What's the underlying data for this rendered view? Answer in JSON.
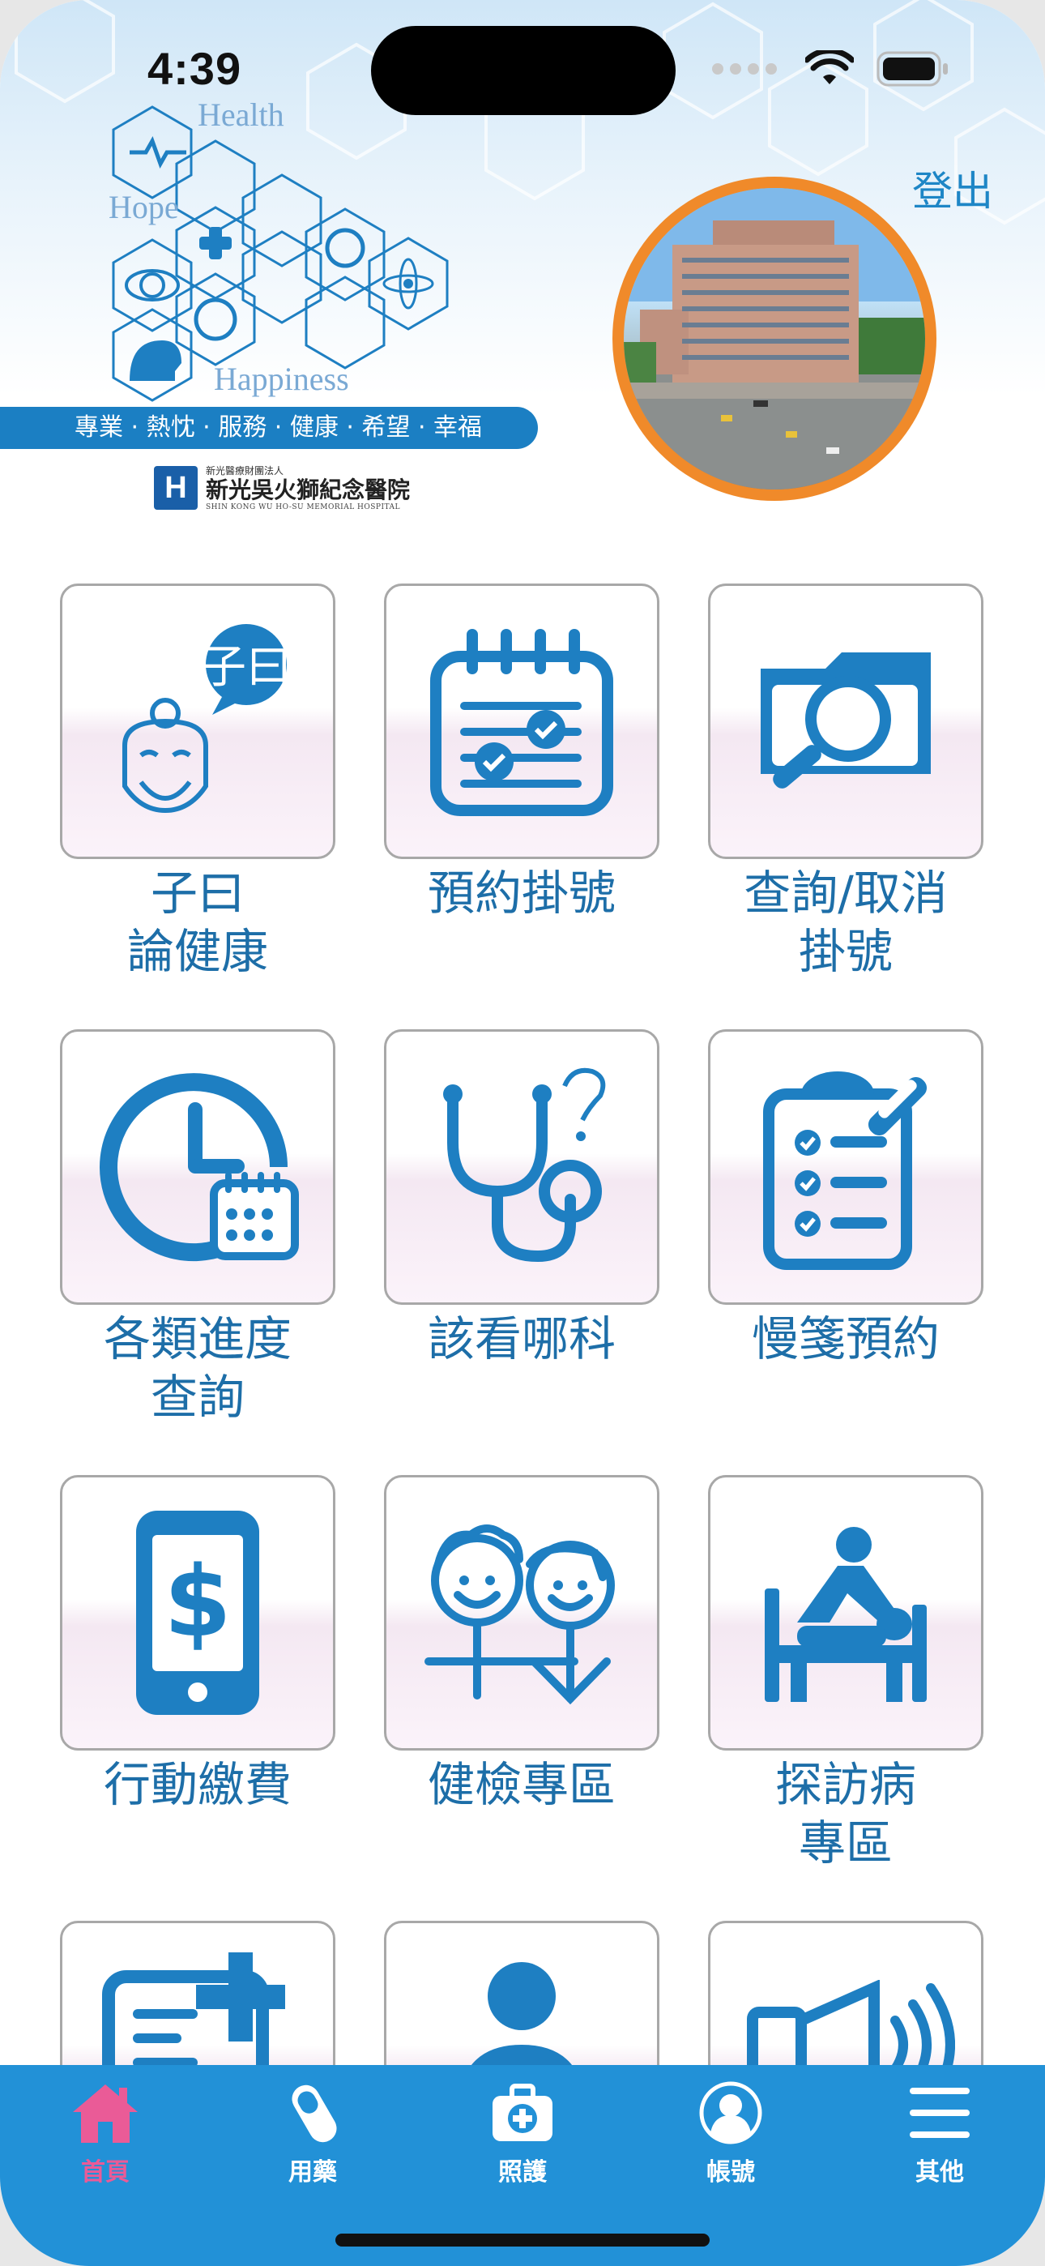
{
  "status_bar": {
    "time": "4:39"
  },
  "header": {
    "logout_label": "登出",
    "logo_words": [
      "Health",
      "Hope",
      "Happiness"
    ],
    "slogan": "專業 · 熱忱 · 服務 · 健康 · 希望 · 幸福",
    "hospital": {
      "small": "新光醫療財團法人",
      "name": "新光吳火獅紀念醫院",
      "en": "SHIN KONG WU HO-SU MEMORIAL HOSPITAL"
    }
  },
  "grid": {
    "tiles": [
      {
        "label": "子曰\n論健康",
        "icon": "confucius-icon"
      },
      {
        "label": "預約掛號",
        "icon": "calendar-check-icon"
      },
      {
        "label": "查詢/取消\n掛號",
        "icon": "folder-search-icon"
      },
      {
        "label": "各類進度\n查詢",
        "icon": "clock-calendar-icon"
      },
      {
        "label": "該看哪科",
        "icon": "stethoscope-question-icon"
      },
      {
        "label": "慢箋預約",
        "icon": "clipboard-checklist-icon"
      },
      {
        "label": "行動繳費",
        "icon": "phone-dollar-icon"
      },
      {
        "label": "健檢專區",
        "icon": "health-check-people-icon"
      },
      {
        "label": "探訪病\n專區",
        "icon": "patient-bed-visit-icon"
      },
      {
        "label": "",
        "icon": "medical-card-icon"
      },
      {
        "label": "",
        "icon": "person-icon"
      },
      {
        "label": "",
        "icon": "megaphone-icon"
      }
    ]
  },
  "tabbar": {
    "items": [
      {
        "label": "首頁",
        "icon": "home-icon",
        "active": true
      },
      {
        "label": "用藥",
        "icon": "pill-icon",
        "active": false
      },
      {
        "label": "照護",
        "icon": "medkit-icon",
        "active": false
      },
      {
        "label": "帳號",
        "icon": "account-icon",
        "active": false
      },
      {
        "label": "其他",
        "icon": "menu-icon",
        "active": false
      }
    ]
  },
  "colors": {
    "primary": "#2291d7",
    "label_blue": "#1d6ea8",
    "active_pink": "#ea5b97",
    "accent_orange": "#f08a2a"
  }
}
